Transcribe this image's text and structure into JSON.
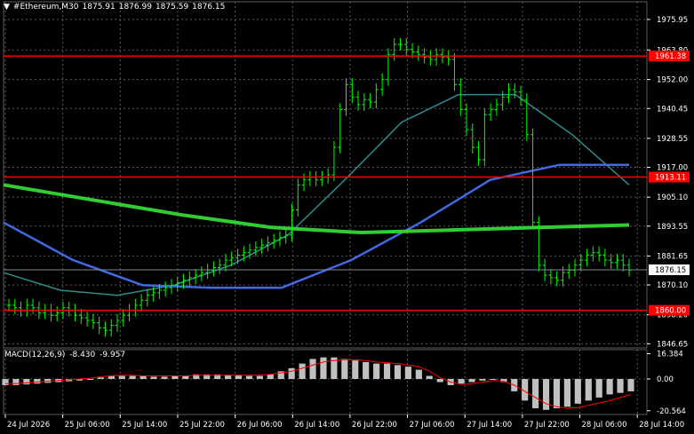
{
  "header": {
    "symbol": "#Ethereum,M30",
    "open": "1875.91",
    "high": "1876.99",
    "low": "1875.59",
    "close": "1876.15"
  },
  "macd_header": {
    "name": "MACD(12,26,9)",
    "main": "-8.430",
    "signal": "-9.957"
  },
  "colors": {
    "background": "#000000",
    "grid": "#5a5a5a",
    "candle": "#00ff00",
    "ma_slow": "#32cd32",
    "ma_mid": "#4169e1",
    "ma_fast": "#2e8b8b",
    "level_line": "#ff0000",
    "level_label_bg": "#ff0000",
    "price_label_bg": "#ffffff",
    "macd_hist": "#c0c0c0",
    "macd_signal": "#ff0000"
  },
  "chart_data": {
    "type": "candlestick",
    "price_axis": {
      "ticks": [
        "1975.95",
        "1963.80",
        "1952.00",
        "1940.45",
        "1928.55",
        "1917.00",
        "1905.10",
        "1893.55",
        "1881.65",
        "1870.10",
        "1858.20",
        "1846.65"
      ],
      "range": [
        1845,
        1983
      ]
    },
    "levels": [
      {
        "price": 1961.38,
        "label": "1961.38"
      },
      {
        "price": 1913.11,
        "label": "1913.11"
      },
      {
        "price": 1860.0,
        "label": "1860.00"
      }
    ],
    "current_price": {
      "price": 1876.15,
      "label": "1876.15"
    },
    "time_axis": [
      "24 Jul 2026",
      "25 Jul 06:00",
      "25 Jul 14:00",
      "25 Jul 22:00",
      "26 Jul 06:00",
      "26 Jul 14:00",
      "26 Jul 22:00",
      "27 Jul 06:00",
      "27 Jul 14:00",
      "27 Jul 22:00",
      "28 Jul 06:00",
      "28 Jul 14:00"
    ],
    "closes": [
      1862,
      1861,
      1860,
      1862,
      1861,
      1859,
      1860,
      1858,
      1859,
      1861,
      1860,
      1858,
      1857,
      1856,
      1855,
      1853,
      1852,
      1854,
      1856,
      1858,
      1860,
      1862,
      1864,
      1866,
      1867,
      1868,
      1869,
      1870,
      1871,
      1872,
      1873,
      1874,
      1875,
      1876,
      1877,
      1878,
      1880,
      1881,
      1882,
      1883,
      1884,
      1885,
      1886,
      1887,
      1888,
      1889,
      1890,
      1900,
      1910,
      1912,
      1913,
      1912,
      1913,
      1914,
      1925,
      1940,
      1950,
      1945,
      1942,
      1944,
      1943,
      1948,
      1952,
      1962,
      1966,
      1966,
      1964,
      1963,
      1962,
      1961,
      1960,
      1962,
      1961,
      1960,
      1950,
      1940,
      1932,
      1925,
      1920,
      1938,
      1940,
      1942,
      1945,
      1948,
      1947,
      1944,
      1930,
      1895,
      1878,
      1874,
      1873,
      1872,
      1875,
      1876,
      1878,
      1880,
      1882,
      1883,
      1882,
      1880,
      1879,
      1880,
      1878,
      1876
    ],
    "ma_slow": [
      1910,
      1904,
      1898,
      1893,
      1891,
      1892,
      1893,
      1894
    ],
    "ma_mid": [
      1895,
      1880,
      1870,
      1869,
      1869,
      1880,
      1895,
      1912,
      1918,
      1918
    ],
    "ma_fast": [
      1875,
      1868,
      1866,
      1870,
      1878,
      1890,
      1912,
      1935,
      1946,
      1946,
      1930,
      1910
    ],
    "macd": {
      "ticks": [
        "16.384",
        "0.00",
        "-20.564"
      ],
      "range": [
        -23,
        19
      ],
      "histogram": [
        -4,
        -4,
        -3.5,
        -3,
        -2.5,
        -2,
        -1.5,
        -1,
        0,
        1,
        2,
        2,
        2,
        2,
        1.5,
        1.5,
        2,
        2,
        3,
        3,
        3,
        2.5,
        2.5,
        2,
        2,
        3,
        5,
        7,
        10,
        13,
        14,
        14,
        13,
        12,
        11,
        10,
        10,
        9,
        8,
        6,
        2,
        -2,
        -4,
        -3,
        -2,
        -1,
        0,
        -2,
        -8,
        -14,
        -19,
        -20,
        -19,
        -18,
        -16,
        -14,
        -12,
        -10,
        -9,
        -8
      ],
      "signal": [
        -3,
        -3,
        -2.5,
        -2,
        -1.5,
        -1,
        -0.5,
        0,
        0.5,
        1.5,
        2,
        2.5,
        2.5,
        2,
        2,
        2,
        2,
        2,
        2.5,
        2.5,
        2.5,
        2.5,
        2.5,
        2.5,
        2.5,
        3,
        4,
        5,
        7,
        9,
        11,
        12,
        12.5,
        12.5,
        12,
        11,
        10.5,
        10,
        9,
        8,
        5,
        1,
        -2,
        -3.5,
        -3,
        -2,
        -1,
        -1.5,
        -4,
        -8,
        -12,
        -16,
        -18,
        -19,
        -18.5,
        -17,
        -15.5,
        -14,
        -12,
        -10
      ]
    }
  }
}
